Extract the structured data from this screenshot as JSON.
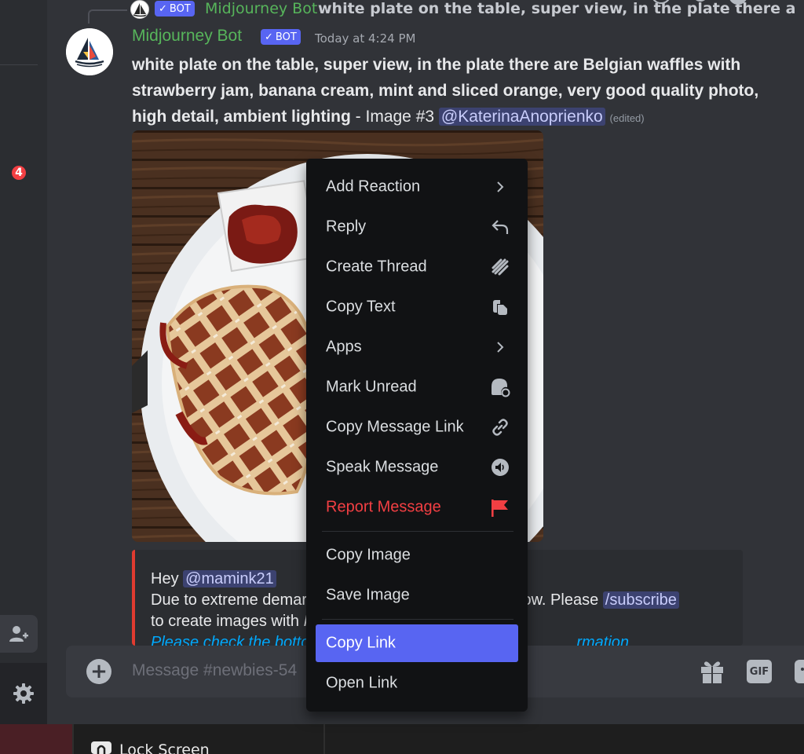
{
  "reply": {
    "author": "Midjourney Bot",
    "bot_label": "BOT",
    "snippet": "white plate on the table, super view, in the plate there are Belgian"
  },
  "message": {
    "author": "Midjourney Bot",
    "bot_label": "BOT",
    "timestamp": "Today at 4:24 PM",
    "prompt": "white plate on the table, super view, in the plate there are Belgian waffles with strawberry jam, banana cream, mint and sliced orange, very good quality photo, high detail, ambient lighting",
    "separator": " - ",
    "image_label": "Image #3",
    "mention": "@KaterinaAnoprienko",
    "edited": "(edited)"
  },
  "embed": {
    "greeting": "Hey",
    "mention": "@mamink21",
    "line2_start": "Due to extreme demar",
    "line2_end": "ght now. Please",
    "command": "/subscribe",
    "line3_start": "to create images with",
    "line3_char": "I",
    "link_start": "Please check the botto",
    "link_end": "rmation"
  },
  "sidebar": {
    "notification_count": "4"
  },
  "composer": {
    "placeholder": "Message #newbies-54",
    "gif_label": "GIF"
  },
  "taskbar": {
    "lock_label": "Lock Screen"
  },
  "context_menu": {
    "items": [
      {
        "label": "Add Reaction",
        "icon": "chevron-right-icon"
      },
      {
        "label": "Reply",
        "icon": "reply-arrow-icon"
      },
      {
        "label": "Create Thread",
        "icon": "thread-icon"
      },
      {
        "label": "Copy Text",
        "icon": "copy-icon"
      },
      {
        "label": "Apps",
        "icon": "chevron-right-icon"
      },
      {
        "label": "Mark Unread",
        "icon": "mark-unread-icon"
      },
      {
        "label": "Copy Message Link",
        "icon": "link-icon"
      },
      {
        "label": "Speak Message",
        "icon": "speaker-icon"
      },
      {
        "label": "Report Message",
        "icon": "flag-icon"
      },
      {
        "label": "Copy Image",
        "icon": ""
      },
      {
        "label": "Save Image",
        "icon": ""
      },
      {
        "label": "Copy Link",
        "icon": ""
      },
      {
        "label": "Open Link",
        "icon": ""
      }
    ],
    "active_item": "Copy Link"
  },
  "colors": {
    "background": "#313338",
    "bot_green": "#57b55b",
    "blurple": "#5865f2",
    "danger": "#f23f43",
    "menu_bg": "#111214"
  }
}
